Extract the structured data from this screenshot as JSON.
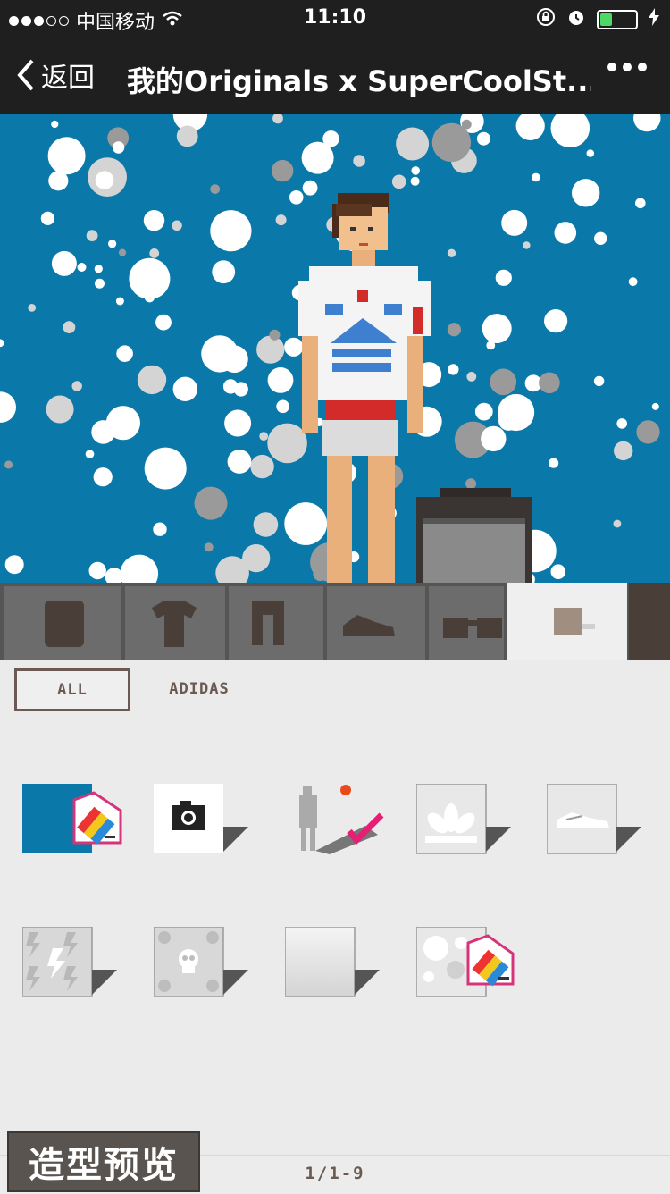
{
  "status_bar": {
    "carrier": "中国移动",
    "time": "11:10",
    "battery_level": 0.35
  },
  "nav_bar": {
    "back_label": "返回",
    "title": "我的Originals x SuperCoolSt..."
  },
  "category_tabs": [
    {
      "name": "face",
      "icon": "face-icon"
    },
    {
      "name": "tops",
      "icon": "tshirt-icon"
    },
    {
      "name": "pants",
      "icon": "pants-icon"
    },
    {
      "name": "shoes",
      "icon": "shoe-icon"
    },
    {
      "name": "accessories",
      "icon": "sunglasses-icon"
    },
    {
      "name": "background",
      "icon": "background-icon",
      "selected": true
    }
  ],
  "filters": {
    "all_label": "ALL",
    "adidas_label": "ADIDAS"
  },
  "background_items": [
    {
      "name": "custom-color",
      "icon": "pencil-icon"
    },
    {
      "name": "camera-photo",
      "icon": "camera-icon"
    },
    {
      "name": "shadow-toggle",
      "icon": "checkmark-icon"
    },
    {
      "name": "trefoil-logo",
      "icon": "trefoil-icon"
    },
    {
      "name": "sneaker-pattern",
      "icon": "sneaker-icon"
    },
    {
      "name": "lightning-pattern",
      "icon": "lightning-icon"
    },
    {
      "name": "skull-pattern",
      "icon": "skull-icon"
    },
    {
      "name": "plain-gradient",
      "icon": "gradient-icon"
    },
    {
      "name": "polka-dots",
      "icon": "polka-pencil-icon"
    }
  ],
  "pager": "1/1-9",
  "preview_button": "造型预览",
  "colors": {
    "scene_bg": "#0a78a8",
    "tab_selected": "#efefef",
    "tab_normal": "#6c6c6c",
    "ink": "#5a4c44",
    "pencil_frame": "#d6347a"
  }
}
